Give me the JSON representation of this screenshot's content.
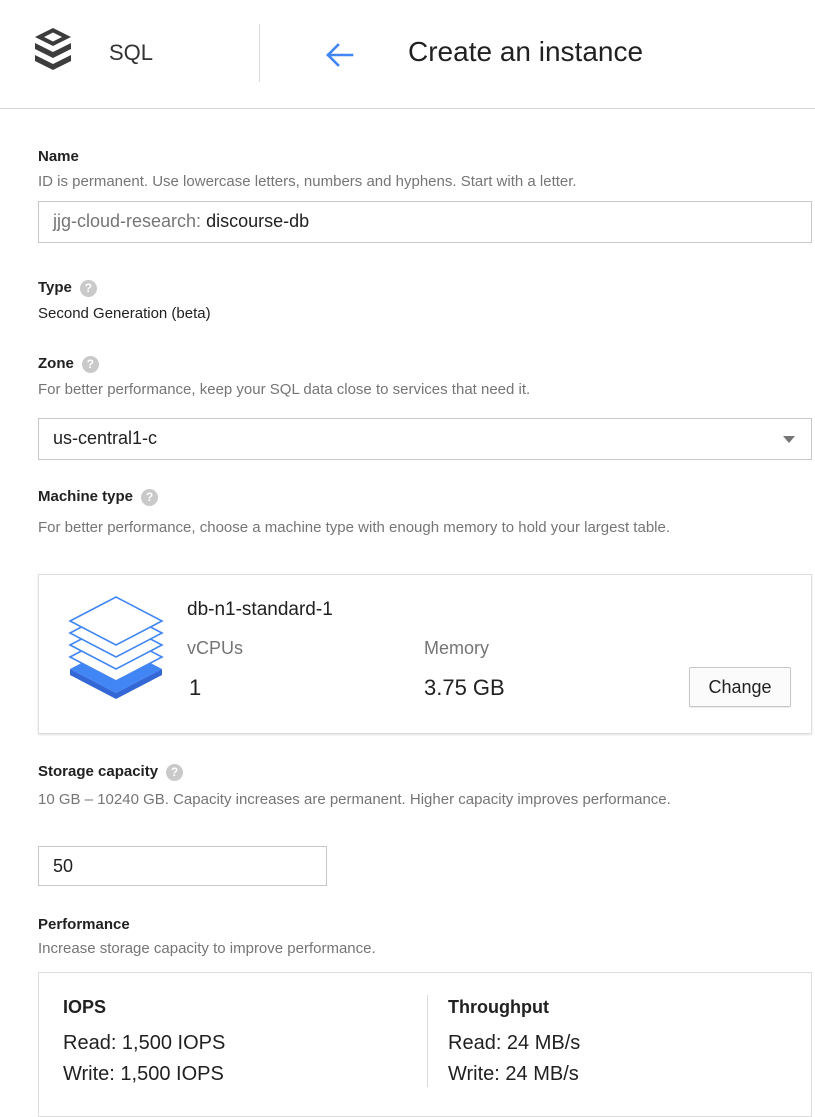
{
  "header": {
    "product": "SQL",
    "title": "Create an instance",
    "logo_icon": "stacked-database-icon",
    "back_icon": "back-arrow-icon",
    "accent_color": "#4285f4"
  },
  "name": {
    "label": "Name",
    "hint": "ID is permanent. Use lowercase letters, numbers and hyphens. Start with a letter.",
    "prefix": "jjg-cloud-research:",
    "value": "discourse-db"
  },
  "type": {
    "label": "Type",
    "value": "Second Generation (beta)"
  },
  "zone": {
    "label": "Zone",
    "hint": "For better performance, keep your SQL data close to services that need it.",
    "selected": "us-central1-c"
  },
  "machine": {
    "label": "Machine type",
    "hint": "For better performance, choose a machine type with enough memory to hold your largest table.",
    "name": "db-n1-standard-1",
    "vcpus_label": "vCPUs",
    "vcpus_value": "1",
    "memory_label": "Memory",
    "memory_value": "3.75 GB",
    "change_label": "Change"
  },
  "storage": {
    "label": "Storage capacity",
    "hint": "10 GB – 10240 GB. Capacity increases are permanent. Higher capacity improves performance.",
    "value": "50"
  },
  "performance": {
    "label": "Performance",
    "hint": "Increase storage capacity to improve performance.",
    "iops": {
      "heading": "IOPS",
      "read": "Read: 1,500 IOPS",
      "write": "Write: 1,500 IOPS"
    },
    "throughput": {
      "heading": "Throughput",
      "read": "Read: 24 MB/s",
      "write": "Write: 24 MB/s"
    }
  },
  "help_glyph": "?"
}
